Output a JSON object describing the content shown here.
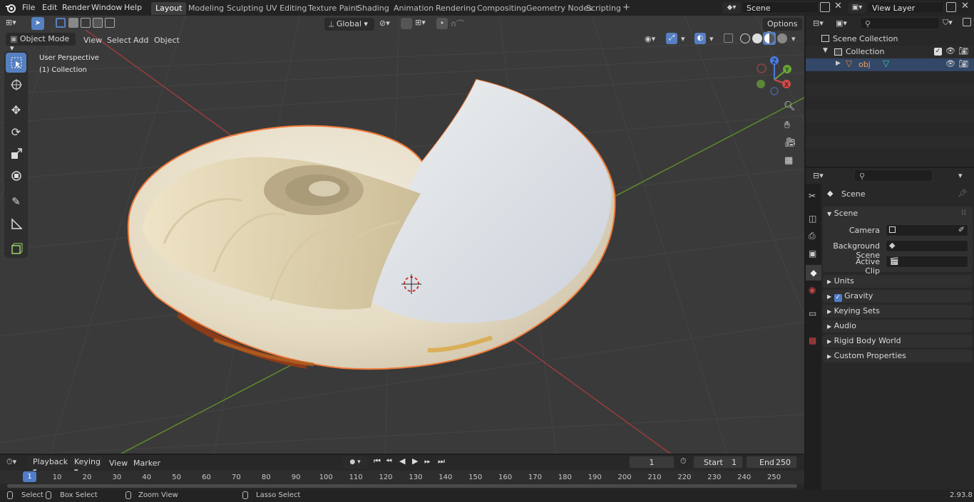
{
  "topbar": {
    "menus": [
      "File",
      "Edit",
      "Render",
      "Window",
      "Help"
    ],
    "workspaces": [
      "Layout",
      "Modeling",
      "Sculpting",
      "UV Editing",
      "Texture Paint",
      "Shading",
      "Animation",
      "Rendering",
      "Compositing",
      "Geometry Nodes",
      "Scripting"
    ],
    "active_workspace": "Layout",
    "add_tab": "+",
    "scene_name": "Scene",
    "view_layer_name": "View Layer"
  },
  "viewport": {
    "mode": "Object Mode",
    "menus": [
      "View",
      "Select",
      "Add",
      "Object"
    ],
    "orientation": "Global",
    "options_label": "Options",
    "overlay_title": "User Perspective",
    "overlay_collection": "(1) Collection",
    "gizmo_axes": {
      "x": "X",
      "y": "Y",
      "z": "Z"
    }
  },
  "outliner": {
    "scene_collection": "Scene Collection",
    "collection": "Collection",
    "object": "obj"
  },
  "properties": {
    "header": "Scene",
    "panel_title": "Scene",
    "camera_label": "Camera",
    "background_scene_label": "Background Scene",
    "active_clip_label": "Active Clip",
    "sections": [
      "Units",
      "Gravity",
      "Keying Sets",
      "Audio",
      "Rigid Body World",
      "Custom Properties"
    ],
    "gravity_checked": true
  },
  "timeline": {
    "menus": [
      "Playback",
      "Keying",
      "View",
      "Marker"
    ],
    "current_frame": "1",
    "start_label": "Start",
    "start_value": "1",
    "end_label": "End",
    "end_value": "250",
    "ruler_current": "1",
    "ticks": [
      "10",
      "20",
      "30",
      "40",
      "50",
      "60",
      "70",
      "80",
      "90",
      "100",
      "110",
      "120",
      "130",
      "140",
      "150",
      "160",
      "170",
      "180",
      "190",
      "200",
      "210",
      "220",
      "230",
      "240",
      "250"
    ]
  },
  "statusbar": {
    "select": "Select",
    "box_select": "Box Select",
    "zoom_view": "Zoom View",
    "lasso_select": "Lasso Select",
    "version": "2.93.8"
  },
  "colors": {
    "accent": "#5680c2",
    "selection_outline": "#f07a3a",
    "x_axis": "#c84a4a",
    "y_axis": "#7aa83a"
  }
}
